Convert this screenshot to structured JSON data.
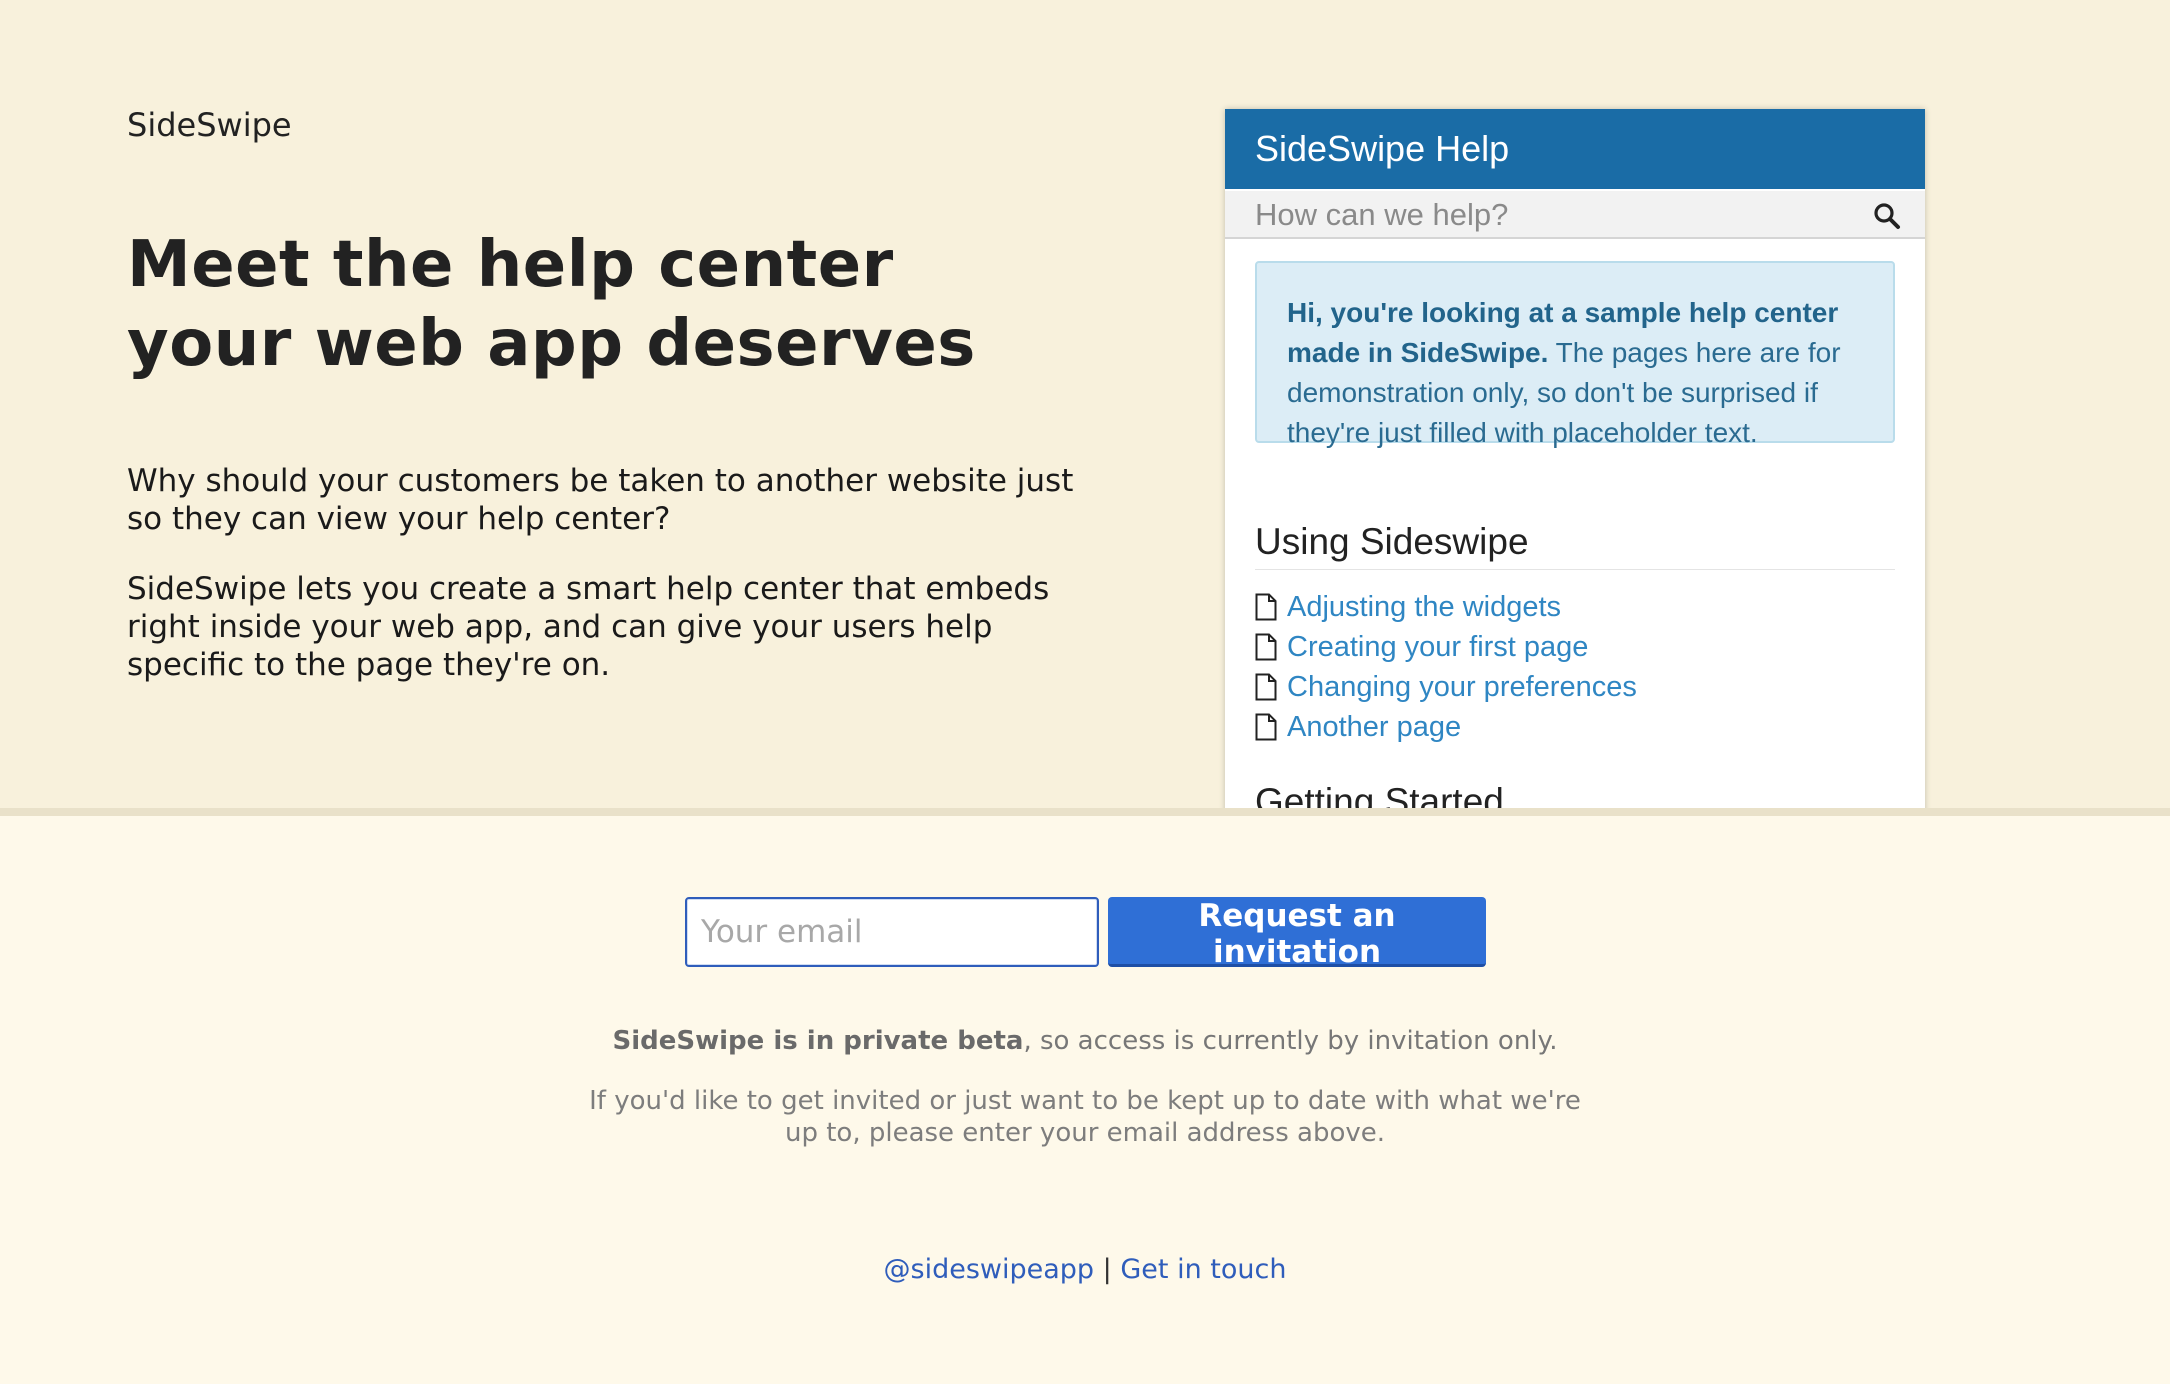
{
  "hero": {
    "brand": "SideSwipe",
    "headline": "Meet the help center your web app deserves",
    "paragraph_1": "Why should your customers be taken to another website just so they can view your help center?",
    "paragraph_2": "SideSwipe lets you create a smart help center that embeds right inside your web app, and can give your users help specific to the page they're on."
  },
  "widget": {
    "title": "SideSwipe Help",
    "search_placeholder": "How can we help?",
    "notice_bold": "Hi, you're looking at a sample help center made in SideSwipe.",
    "notice_text": " The pages here are for demonstration only, so don't be surprised if they're just filled with placeholder text.",
    "sections": [
      {
        "title": "Using Sideswipe",
        "pages": [
          "Adjusting the widgets",
          "Creating your first page",
          "Changing your preferences",
          "Another page"
        ]
      },
      {
        "title": "Getting Started"
      }
    ],
    "icons": {
      "search": "search-icon",
      "page": "document-icon"
    },
    "colors": {
      "header": "#1a6ca6",
      "link": "#2f86c3",
      "notice_bg": "#dcedf6"
    }
  },
  "signup": {
    "email_placeholder": "Your email",
    "button_label": "Request an invitation",
    "beta_bold": "SideSwipe is in private beta",
    "beta_text": ", so access is currently by invitation only.",
    "invite_text": "If you'd like to get invited or just want to be kept up to date with what we're up to, please enter your email address above.",
    "button_color": "#2f6fd6"
  },
  "footer": {
    "twitter_link": "@sideswipeapp",
    "separator": "|",
    "contact_link": "Get in touch"
  }
}
